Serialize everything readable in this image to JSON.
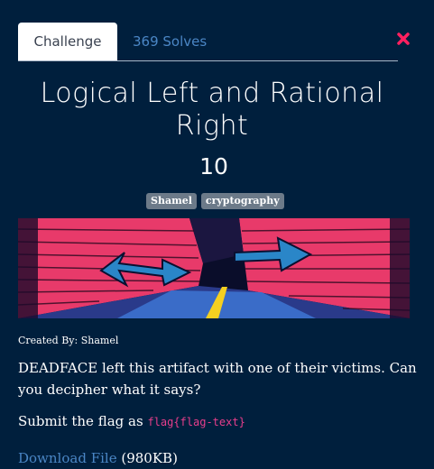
{
  "tabs": {
    "challenge": "Challenge",
    "solves": "369 Solves"
  },
  "challenge": {
    "title": "Logical Left and Rational Right",
    "value": "10",
    "tags": [
      "Shamel",
      "cryptography"
    ],
    "created_by": "Created By: Shamel",
    "description": "DEADFACE left this artifact with one of their victims. Can you decipher what it says?",
    "submit_prefix": "Submit the flag as",
    "flag_format": "flag{flag-text}",
    "download_label": "Download File",
    "file_size": "(980KB)"
  },
  "icons": {
    "close": "close-x-icon",
    "banner": "alley-arrows-image"
  },
  "colors": {
    "background": "#001f3d",
    "link": "#4a86c5",
    "flag": "#e83e8c",
    "close": "#ff2060",
    "tag": "#6c7a89"
  }
}
